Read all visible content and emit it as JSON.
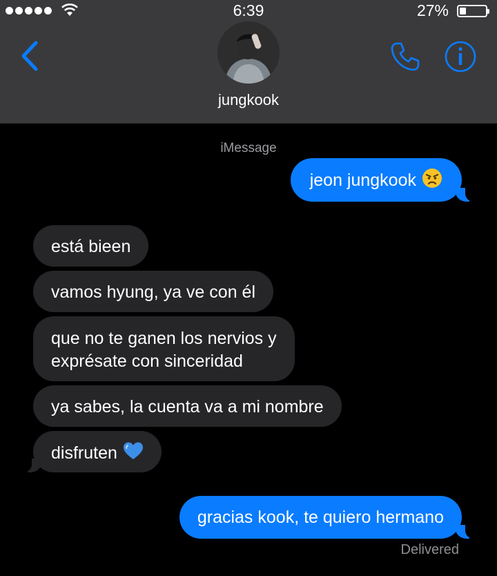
{
  "status_bar": {
    "time": "6:39",
    "battery_percent": "27%",
    "signal_bars": 5,
    "battery_level": 0.27
  },
  "header": {
    "contact_name": "jungkook",
    "accent_color": "#0a7cff",
    "back_icon": "chevron-left-icon",
    "call_icon": "phone-icon",
    "info_icon": "info-icon"
  },
  "conversation": {
    "service_label": "iMessage",
    "messages": [
      {
        "direction": "outgoing",
        "text": "jeon jungkook",
        "emoji": "angry-face"
      },
      {
        "direction": "incoming",
        "text": "está bieen"
      },
      {
        "direction": "incoming",
        "text": "vamos hyung, ya ve con él"
      },
      {
        "direction": "incoming",
        "lines": [
          "que no te ganen los nervios y",
          "exprésate con sinceridad"
        ]
      },
      {
        "direction": "incoming",
        "text": "ya sabes, la cuenta va a mi nombre"
      },
      {
        "direction": "incoming",
        "text": "disfruten",
        "emoji": "blue-heart"
      },
      {
        "direction": "outgoing",
        "text": "gracias kook, te quiero hermano"
      }
    ],
    "delivery_status": "Delivered"
  },
  "colors": {
    "outgoing_bubble": "#0a7cff",
    "incoming_bubble": "#262629",
    "header_background": "#3a3a3c",
    "background": "#000000"
  }
}
